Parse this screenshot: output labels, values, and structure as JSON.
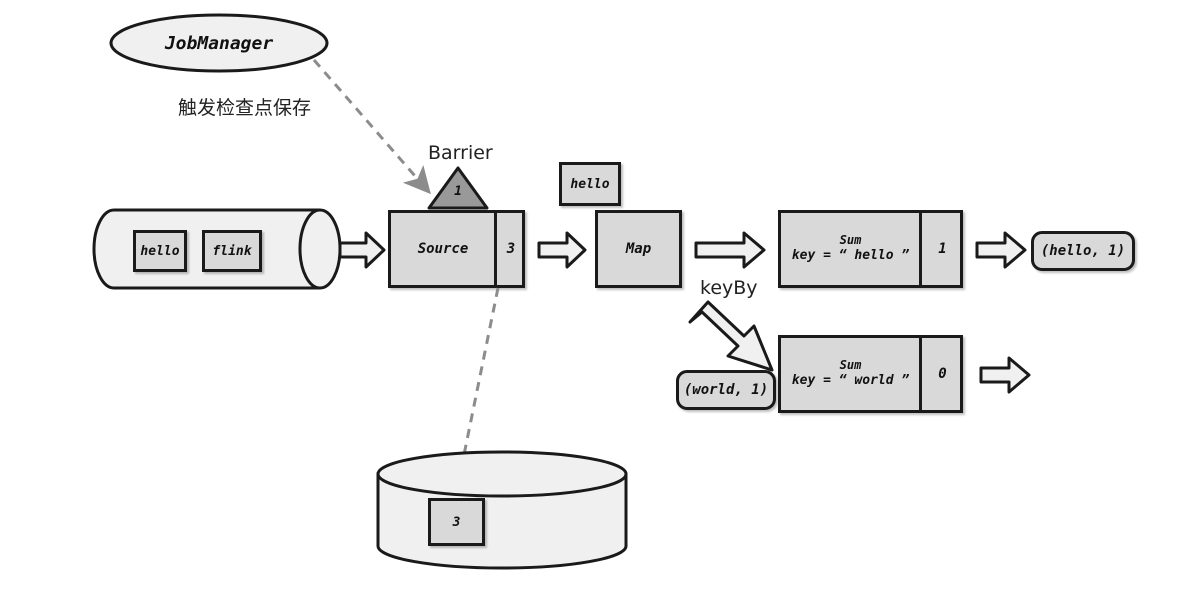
{
  "diagram": {
    "title_note": "Flink checkpoint barrier flow diagram",
    "jobmanager": {
      "label": "JobManager"
    },
    "trigger_label": "触发检查点保存",
    "barrier": {
      "caption": "Barrier",
      "value": "1"
    },
    "source_stream": {
      "records": [
        {
          "label": "hello"
        },
        {
          "label": "flink"
        }
      ]
    },
    "source_operator": {
      "name": "Source",
      "state": "3"
    },
    "map_operator": {
      "name": "Map"
    },
    "map_record": {
      "label": "hello"
    },
    "keyby_label": "keyBy",
    "sum_operators": [
      {
        "title": "Sum",
        "key_line": "key = “ hello ”",
        "state": "1"
      },
      {
        "title": "Sum",
        "key_line": "key = “ world ”",
        "state": "0"
      }
    ],
    "outputs": [
      {
        "label": "(hello, 1)"
      }
    ],
    "keyed_input": {
      "label": "(world, 1)"
    },
    "state_backend": {
      "snapshot_label": "3"
    },
    "colors": {
      "box_fill": "#d9d9d9",
      "light_fill": "#f0f0f0",
      "stroke": "#1a1a1a",
      "barrier_fill": "#999999",
      "dashed_arrow": "#8c8c8c",
      "text": "#111111"
    }
  }
}
